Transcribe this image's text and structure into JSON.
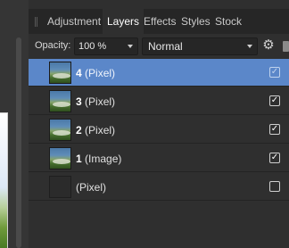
{
  "tabs": [
    {
      "label": "Adjustment",
      "active": false
    },
    {
      "label": "Layers",
      "active": true
    },
    {
      "label": "Effects",
      "active": false
    },
    {
      "label": "Styles",
      "active": false
    },
    {
      "label": "Stock",
      "active": false
    }
  ],
  "options": {
    "opacity_label": "Opacity:",
    "opacity_value": "100 %",
    "blend_mode": "Normal"
  },
  "layers": [
    {
      "number": "4",
      "kind": "(Pixel)",
      "selected": true,
      "visible": true
    },
    {
      "number": "3",
      "kind": "(Pixel)",
      "selected": false,
      "visible": true
    },
    {
      "number": "2",
      "kind": "(Pixel)",
      "selected": false,
      "visible": true
    },
    {
      "number": "1",
      "kind": "(Image)",
      "selected": false,
      "visible": true
    },
    {
      "number": "",
      "kind": "(Pixel)",
      "selected": false,
      "visible": false
    }
  ],
  "colors": {
    "selection": "#5b87c9",
    "panel_bg": "#2f2f2f",
    "tab_bar_bg": "#262626"
  },
  "icons": {
    "settings": "gear-icon",
    "lock": "lock-icon",
    "visibility": "checkbox-icon"
  }
}
